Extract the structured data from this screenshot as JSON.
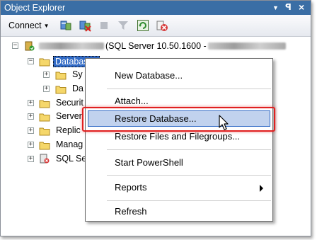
{
  "window": {
    "title": "Object Explorer",
    "controls": {
      "dropdown": "▼",
      "pin": "ꟼ",
      "close": "×"
    }
  },
  "toolbar": {
    "connect_label": "Connect",
    "icons": [
      "connect-server-icon",
      "disconnect-icon",
      "stop-icon",
      "filter-icon",
      "refresh-icon",
      "delete-icon"
    ]
  },
  "tree": {
    "server_prefix": "",
    "server_info": "(SQL Server 10.50.1600 -",
    "nodes": {
      "databases": "Databases",
      "system_db": "Sy",
      "db_snapshots": "Da",
      "security": "Securit",
      "server_objects": "Server",
      "replication": "Replic",
      "management": "Manag",
      "sql_agent": "SQL Se"
    }
  },
  "context_menu": {
    "items": [
      {
        "label": "New Database..."
      },
      {
        "label": "Attach..."
      },
      {
        "label": "Restore Database..."
      },
      {
        "label": "Restore Files and Filegroups..."
      },
      {
        "label": "Start PowerShell"
      },
      {
        "label": "Reports"
      },
      {
        "label": "Refresh"
      }
    ],
    "highlighted_item": "Restore Database..."
  },
  "colors": {
    "title_bar": "#3a6ea5",
    "selection": "#316ac5",
    "menu_highlight": "#c1d2ee",
    "callout_border": "#e02020"
  }
}
